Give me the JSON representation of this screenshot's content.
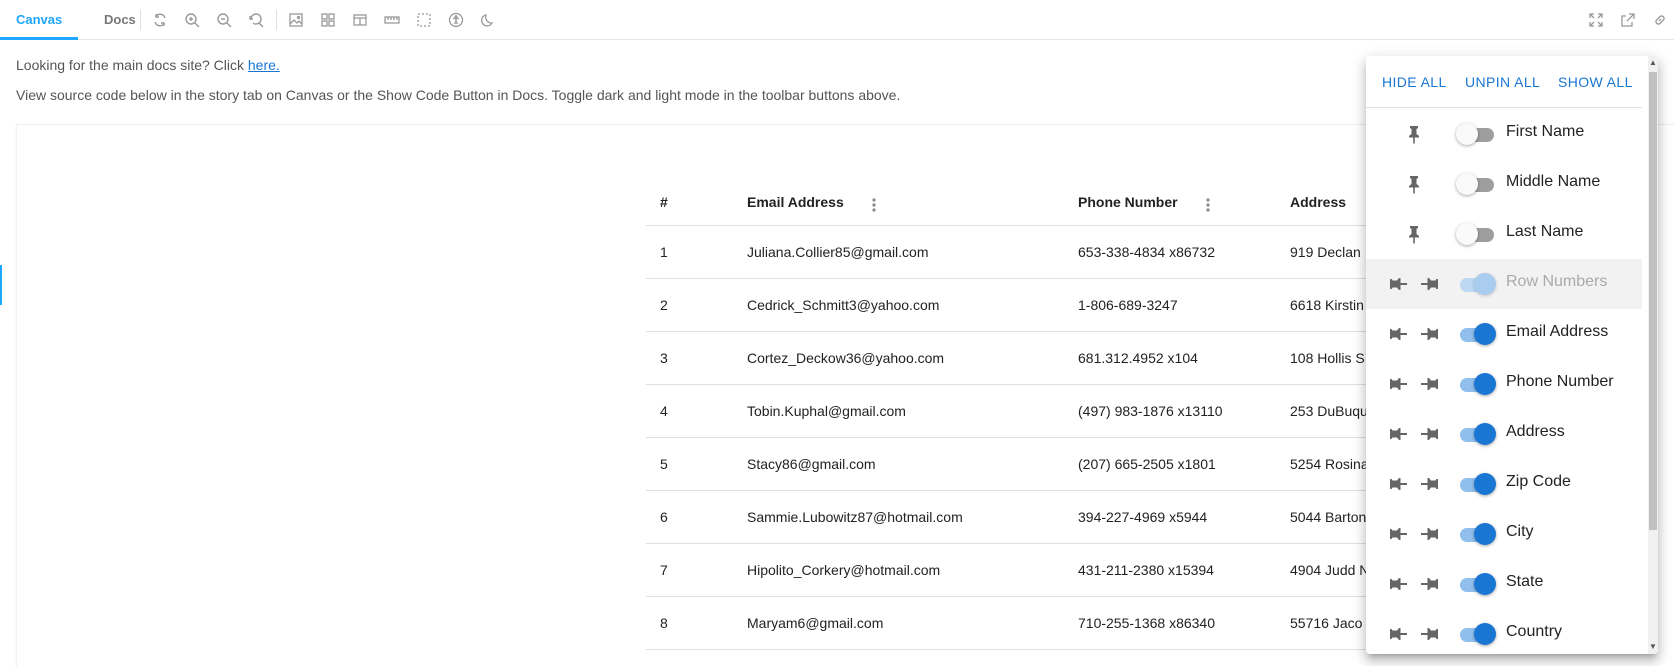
{
  "toolbar": {
    "tabs": [
      {
        "label": "Canvas",
        "active": true
      },
      {
        "label": "Docs",
        "active": false
      }
    ],
    "tool_icons": [
      "reload-icon",
      "zoom-in-icon",
      "zoom-out-icon",
      "zoom-reset-icon",
      "background-icon",
      "grid-icon",
      "viewport-icon",
      "measure-icon",
      "outline-icon",
      "accessibility-icon",
      "dark-mode-icon"
    ],
    "right_icons": [
      "fullscreen-icon",
      "open-new-tab-icon",
      "copy-link-icon"
    ]
  },
  "intro": {
    "line1_text": "Looking for the main docs site? Click ",
    "line1_link": "here.",
    "line2_text": "View source code below in the story tab on Canvas or the Show Code Button in Docs. Toggle dark and light mode in the toolbar buttons above."
  },
  "table": {
    "headers": [
      "#",
      "Email Address",
      "Phone Number",
      "Address"
    ],
    "rows": [
      [
        "1",
        "Juliana.Collier85@gmail.com",
        "653-338-4834 x86732",
        "919 Declan"
      ],
      [
        "2",
        "Cedrick_Schmitt3@yahoo.com",
        "1-806-689-3247",
        "6618 Kirstin"
      ],
      [
        "3",
        "Cortez_Deckow36@yahoo.com",
        "681.312.4952 x104",
        "108 Hollis S"
      ],
      [
        "4",
        "Tobin.Kuphal@gmail.com",
        "(497) 983-1876 x13110",
        "253 DuBuqu"
      ],
      [
        "5",
        "Stacy86@gmail.com",
        "(207) 665-2505 x1801",
        "5254 Rosina"
      ],
      [
        "6",
        "Sammie.Lubowitz87@hotmail.com",
        "394-227-4969 x5944",
        "5044 Barton"
      ],
      [
        "7",
        "Hipolito_Corkery@hotmail.com",
        "431-211-2380 x15394",
        "4904 Judd N"
      ],
      [
        "8",
        "Maryam6@gmail.com",
        "710-255-1368 x86340",
        "55716 Jaco"
      ]
    ]
  },
  "popover": {
    "actions": [
      "Hide All",
      "Unpin All",
      "Show All"
    ],
    "columns": [
      {
        "label": "First Name",
        "visible": false,
        "pin_mode": "single",
        "disabled": false
      },
      {
        "label": "Middle Name",
        "visible": false,
        "pin_mode": "single",
        "disabled": false
      },
      {
        "label": "Last Name",
        "visible": false,
        "pin_mode": "single",
        "disabled": false
      },
      {
        "label": "Row Numbers",
        "visible": true,
        "pin_mode": "double",
        "disabled": true
      },
      {
        "label": "Email Address",
        "visible": true,
        "pin_mode": "double",
        "disabled": false
      },
      {
        "label": "Phone Number",
        "visible": true,
        "pin_mode": "double",
        "disabled": false
      },
      {
        "label": "Address",
        "visible": true,
        "pin_mode": "double",
        "disabled": false
      },
      {
        "label": "Zip Code",
        "visible": true,
        "pin_mode": "double",
        "disabled": false
      },
      {
        "label": "City",
        "visible": true,
        "pin_mode": "double",
        "disabled": false
      },
      {
        "label": "State",
        "visible": true,
        "pin_mode": "double",
        "disabled": false
      },
      {
        "label": "Country",
        "visible": true,
        "pin_mode": "double",
        "disabled": false
      }
    ]
  },
  "colors": {
    "accent": "#1ea7fd",
    "primary": "#1976d2"
  }
}
